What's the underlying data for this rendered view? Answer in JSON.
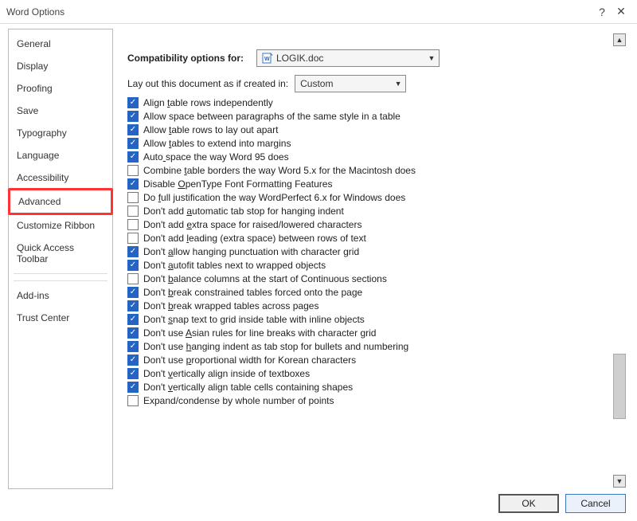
{
  "window": {
    "title": "Word Options",
    "help_aria": "Help",
    "close_aria": "Close"
  },
  "sidebar": {
    "items": [
      "General",
      "Display",
      "Proofing",
      "Save",
      "Typography",
      "Language",
      "Accessibility",
      "Advanced",
      "Customize Ribbon",
      "Quick Access Toolbar",
      "Add-ins",
      "Trust Center"
    ],
    "selected_index": 7
  },
  "compat": {
    "label": "Compatibility options for:",
    "doc_name": "LOGIK.doc",
    "layout_label": "Lay out this document as if created in:",
    "layout_value": "Custom"
  },
  "options": [
    {
      "checked": true,
      "label": "Align table rows independently",
      "ulpos": 6
    },
    {
      "checked": true,
      "label": "Allow space between paragraphs of the same style in a table"
    },
    {
      "checked": true,
      "label": "Allow table rows to lay out apart",
      "ulpos": 6
    },
    {
      "checked": true,
      "label": "Allow tables to extend into margins",
      "ulpos": 6
    },
    {
      "checked": true,
      "label": "Auto space the way Word 95 does",
      "ulpos": 4
    },
    {
      "checked": false,
      "label": "Combine table borders the way Word 5.x for the Macintosh does",
      "ulpos": 8
    },
    {
      "checked": true,
      "label": "Disable OpenType Font Formatting Features",
      "ulpos": 8
    },
    {
      "checked": false,
      "label": "Do full justification the way WordPerfect 6.x for Windows does",
      "ulpos": 3
    },
    {
      "checked": false,
      "label": "Don't add automatic tab stop for hanging indent",
      "ulpos": 10
    },
    {
      "checked": false,
      "label": "Don't add extra space for raised/lowered characters",
      "ulpos": 10
    },
    {
      "checked": false,
      "label": "Don't add leading (extra space) between rows of text",
      "ulpos": 10
    },
    {
      "checked": true,
      "label": "Don't allow hanging punctuation with character grid",
      "ulpos": 6
    },
    {
      "checked": true,
      "label": "Don't autofit tables next to wrapped objects",
      "ulpos": 6
    },
    {
      "checked": false,
      "label": "Don't balance columns at the start of Continuous sections",
      "ulpos": 6
    },
    {
      "checked": true,
      "label": "Don't break constrained tables forced onto the page",
      "ulpos": 6
    },
    {
      "checked": true,
      "label": "Don't break wrapped tables across pages",
      "ulpos": 6
    },
    {
      "checked": true,
      "label": "Don't snap text to grid inside table with inline objects",
      "ulpos": 6
    },
    {
      "checked": true,
      "label": "Don't use Asian rules for line breaks with character grid",
      "ulpos": 10
    },
    {
      "checked": true,
      "label": "Don't use hanging indent as tab stop for bullets and numbering",
      "ulpos": 10
    },
    {
      "checked": true,
      "label": "Don't use proportional width for Korean characters",
      "ulpos": 10
    },
    {
      "checked": true,
      "label": "Don't vertically align inside of textboxes",
      "ulpos": 6
    },
    {
      "checked": true,
      "label": "Don't vertically align table cells containing shapes",
      "ulpos": 6
    },
    {
      "checked": false,
      "label": "Expand/condense by whole number of points"
    }
  ],
  "footer": {
    "ok": "OK",
    "cancel": "Cancel"
  }
}
